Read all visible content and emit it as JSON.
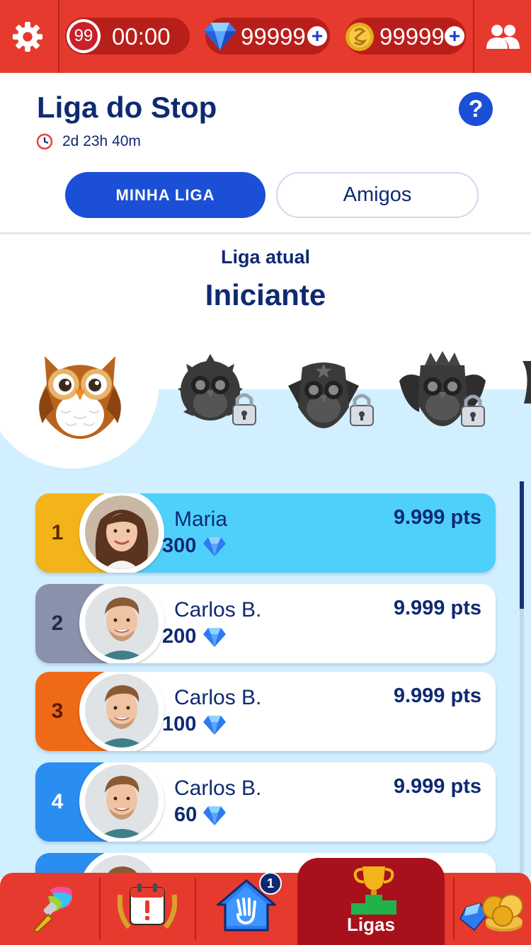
{
  "topbar": {
    "lives_count": "99",
    "lives_timer": "00:00",
    "gems": "99999",
    "coins": "99999",
    "plus": "+"
  },
  "header": {
    "title": "Liga do Stop",
    "time_left": "2d 23h 40m",
    "help": "?"
  },
  "tabs": [
    {
      "label": "MINHA LIGA",
      "active": true
    },
    {
      "label": "Amigos",
      "active": false
    }
  ],
  "league": {
    "subtitle": "Liga atual",
    "name": "Iniciante",
    "badges": [
      {
        "icon": "owl-bronze-icon",
        "locked": false
      },
      {
        "icon": "owl-locked-icon",
        "locked": true
      },
      {
        "icon": "owl-locked-icon",
        "locked": true
      },
      {
        "icon": "owl-locked-icon",
        "locked": true
      }
    ]
  },
  "ranking": [
    {
      "rank": "1",
      "name": "Maria",
      "points": "9.999 pts",
      "reward": "300",
      "rank_color": "#f2b418",
      "rank_text_color": "#5a2a00",
      "highlight": true
    },
    {
      "rank": "2",
      "name": "Carlos B.",
      "points": "9.999 pts",
      "reward": "200",
      "rank_color": "#8a91ab",
      "rank_text_color": "#1d2a52",
      "highlight": false
    },
    {
      "rank": "3",
      "name": "Carlos B.",
      "points": "9.999 pts",
      "reward": "100",
      "rank_color": "#ef6a16",
      "rank_text_color": "#5a1a00",
      "highlight": false
    },
    {
      "rank": "4",
      "name": "Carlos B.",
      "points": "9.999 pts",
      "reward": "60",
      "rank_color": "#2a8df0",
      "rank_text_color": "#ffffff",
      "highlight": false
    }
  ],
  "bottom_nav": {
    "active_label": "Ligas",
    "home_badge": "1",
    "items": [
      "paint-brush-icon",
      "daily-calendar-icon",
      "home-icon",
      "trophy-icon",
      "shop-icon"
    ]
  },
  "colors": {
    "red": "#e63a2e",
    "navy": "#0f2a72",
    "blue": "#1a4fd6",
    "light_blue": "#d2efff",
    "highlight": "#4fd0fb"
  }
}
